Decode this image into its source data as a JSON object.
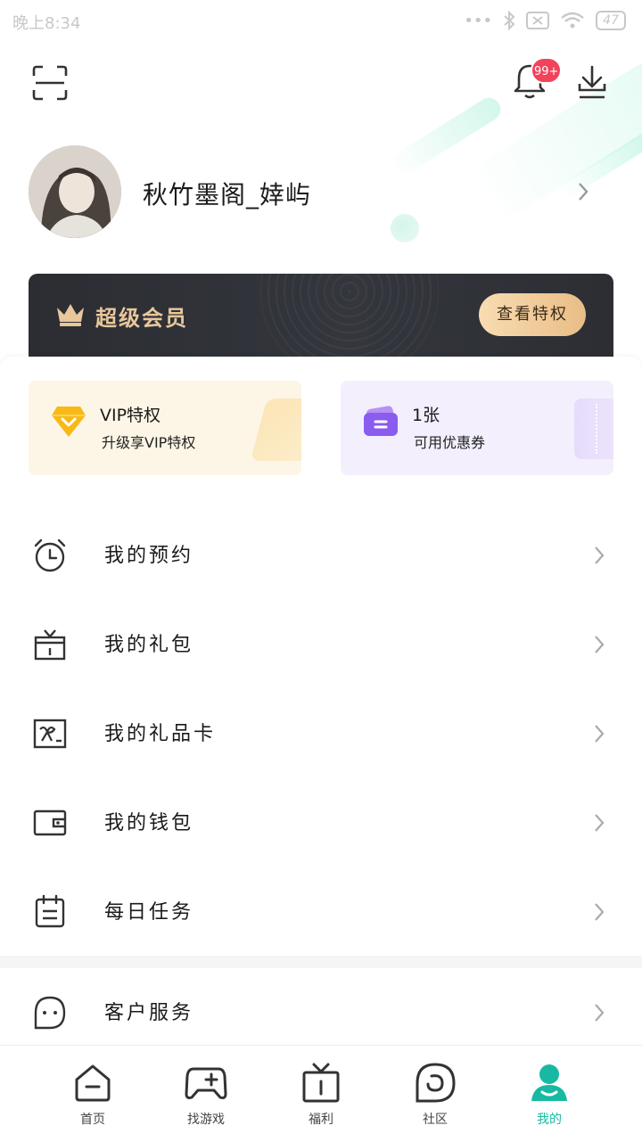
{
  "status_bar": {
    "time": "晚上8:34",
    "battery": "47"
  },
  "header": {
    "notification_badge": "99+",
    "username": "秋竹墨阁_婞屿"
  },
  "vip_banner": {
    "title": "超级会员",
    "button": "查看特权"
  },
  "tiles": {
    "vip": {
      "title": "VIP特权",
      "subtitle": "升级享VIP特权"
    },
    "coupon": {
      "title": "1张",
      "subtitle": "可用优惠券"
    }
  },
  "menu": [
    {
      "label": "我的预约",
      "icon": "alarm-clock-icon"
    },
    {
      "label": "我的礼包",
      "icon": "gift-box-icon"
    },
    {
      "label": "我的礼品卡",
      "icon": "gift-card-icon"
    },
    {
      "label": "我的钱包",
      "icon": "wallet-icon"
    },
    {
      "label": "每日任务",
      "icon": "task-calendar-icon"
    },
    {
      "label": "客户服务",
      "icon": "customer-service-icon"
    }
  ],
  "bottom_nav": [
    {
      "label": "首页",
      "icon": "home-icon"
    },
    {
      "label": "找游戏",
      "icon": "gamepad-icon"
    },
    {
      "label": "福利",
      "icon": "gift-icon"
    },
    {
      "label": "社区",
      "icon": "community-icon"
    },
    {
      "label": "我的",
      "icon": "profile-icon",
      "active": true
    }
  ],
  "colors": {
    "accent": "#18b9a3",
    "badge": "#f2435a",
    "vip_gold": "#e9c79b",
    "vip_bg": "#2b2d33"
  }
}
